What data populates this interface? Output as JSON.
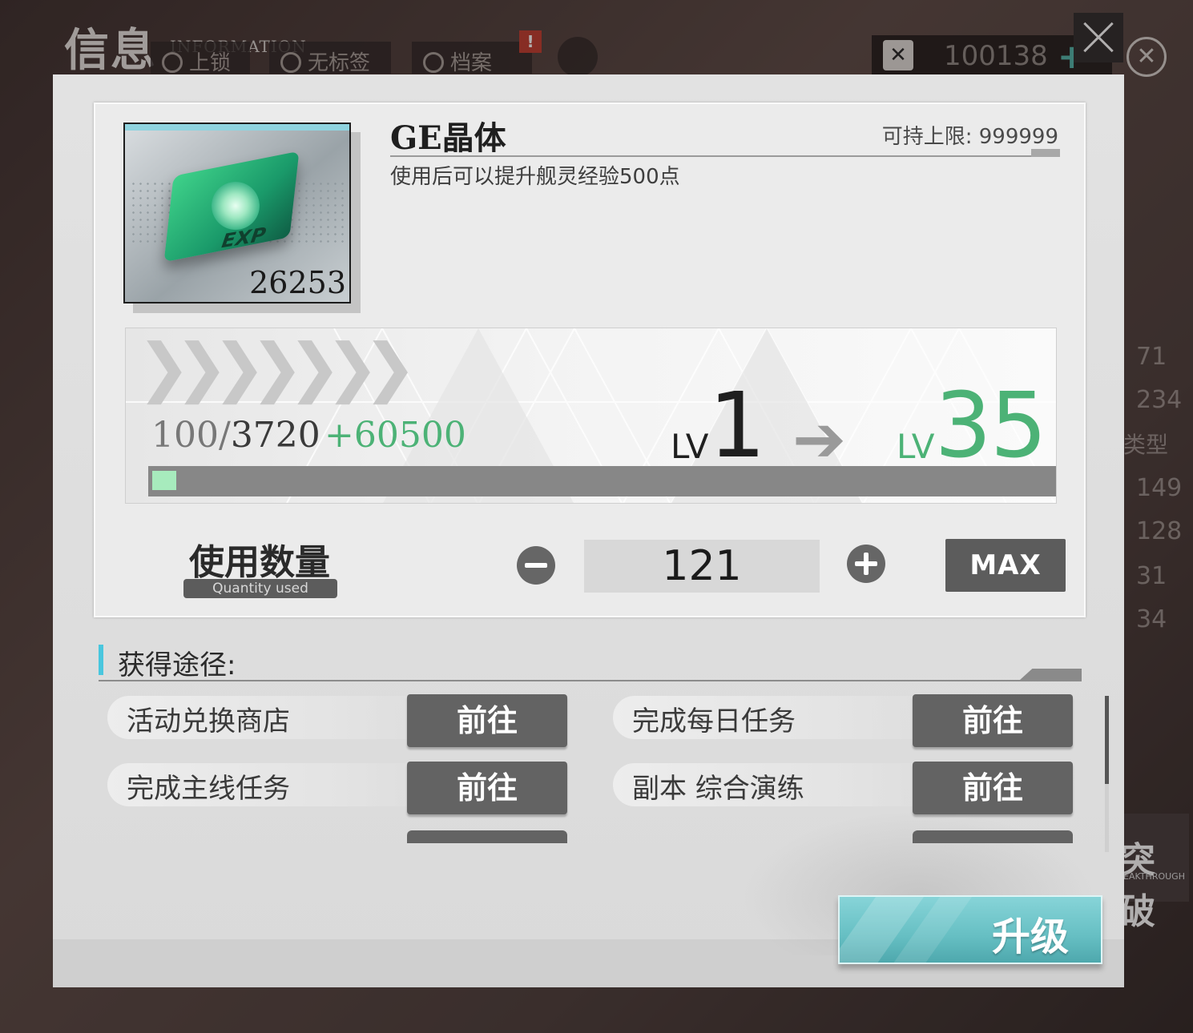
{
  "header": {
    "title": "信息",
    "title_en": "INFORMATION",
    "tabs": [
      {
        "label": "上锁",
        "icon": "lock-icon"
      },
      {
        "label": "无标签",
        "icon": "no-tag-icon"
      },
      {
        "label": "档案",
        "icon": "heart-icon"
      }
    ],
    "alert": "!",
    "currency": {
      "value": "100138",
      "plus": "+"
    }
  },
  "background": {
    "right_numbers": [
      "71",
      "234",
      "149",
      "128",
      "31",
      "34"
    ],
    "type_label": "类型",
    "breakthrough": {
      "zh": "突破",
      "en": "EAKTHROUGH"
    }
  },
  "item": {
    "name": "GE晶体",
    "limit_label": "可持上限: 999999",
    "description": "使用后可以提升舰灵经验500点",
    "count": "26253",
    "badge": "EXP"
  },
  "exp": {
    "current": "100",
    "max": "3720",
    "gain": "+60500",
    "lv_label": "LV",
    "current_level": "1",
    "new_level": "35",
    "bar_fraction": 0.027
  },
  "quantity": {
    "label": "使用数量",
    "sublabel": "Quantity used",
    "value": "121",
    "max_label": "MAX"
  },
  "sources": {
    "title": "获得途径:",
    "go_label": "前往",
    "items": [
      {
        "label": "活动兑换商店"
      },
      {
        "label": "完成每日任务"
      },
      {
        "label": "完成主线任务"
      },
      {
        "label": "副本 综合演练"
      }
    ]
  },
  "upgrade": {
    "label": "升级"
  },
  "colors": {
    "accent_green": "#4cb276",
    "accent_teal": "#66bfc3",
    "bar_fill": "#a7ebbd"
  }
}
